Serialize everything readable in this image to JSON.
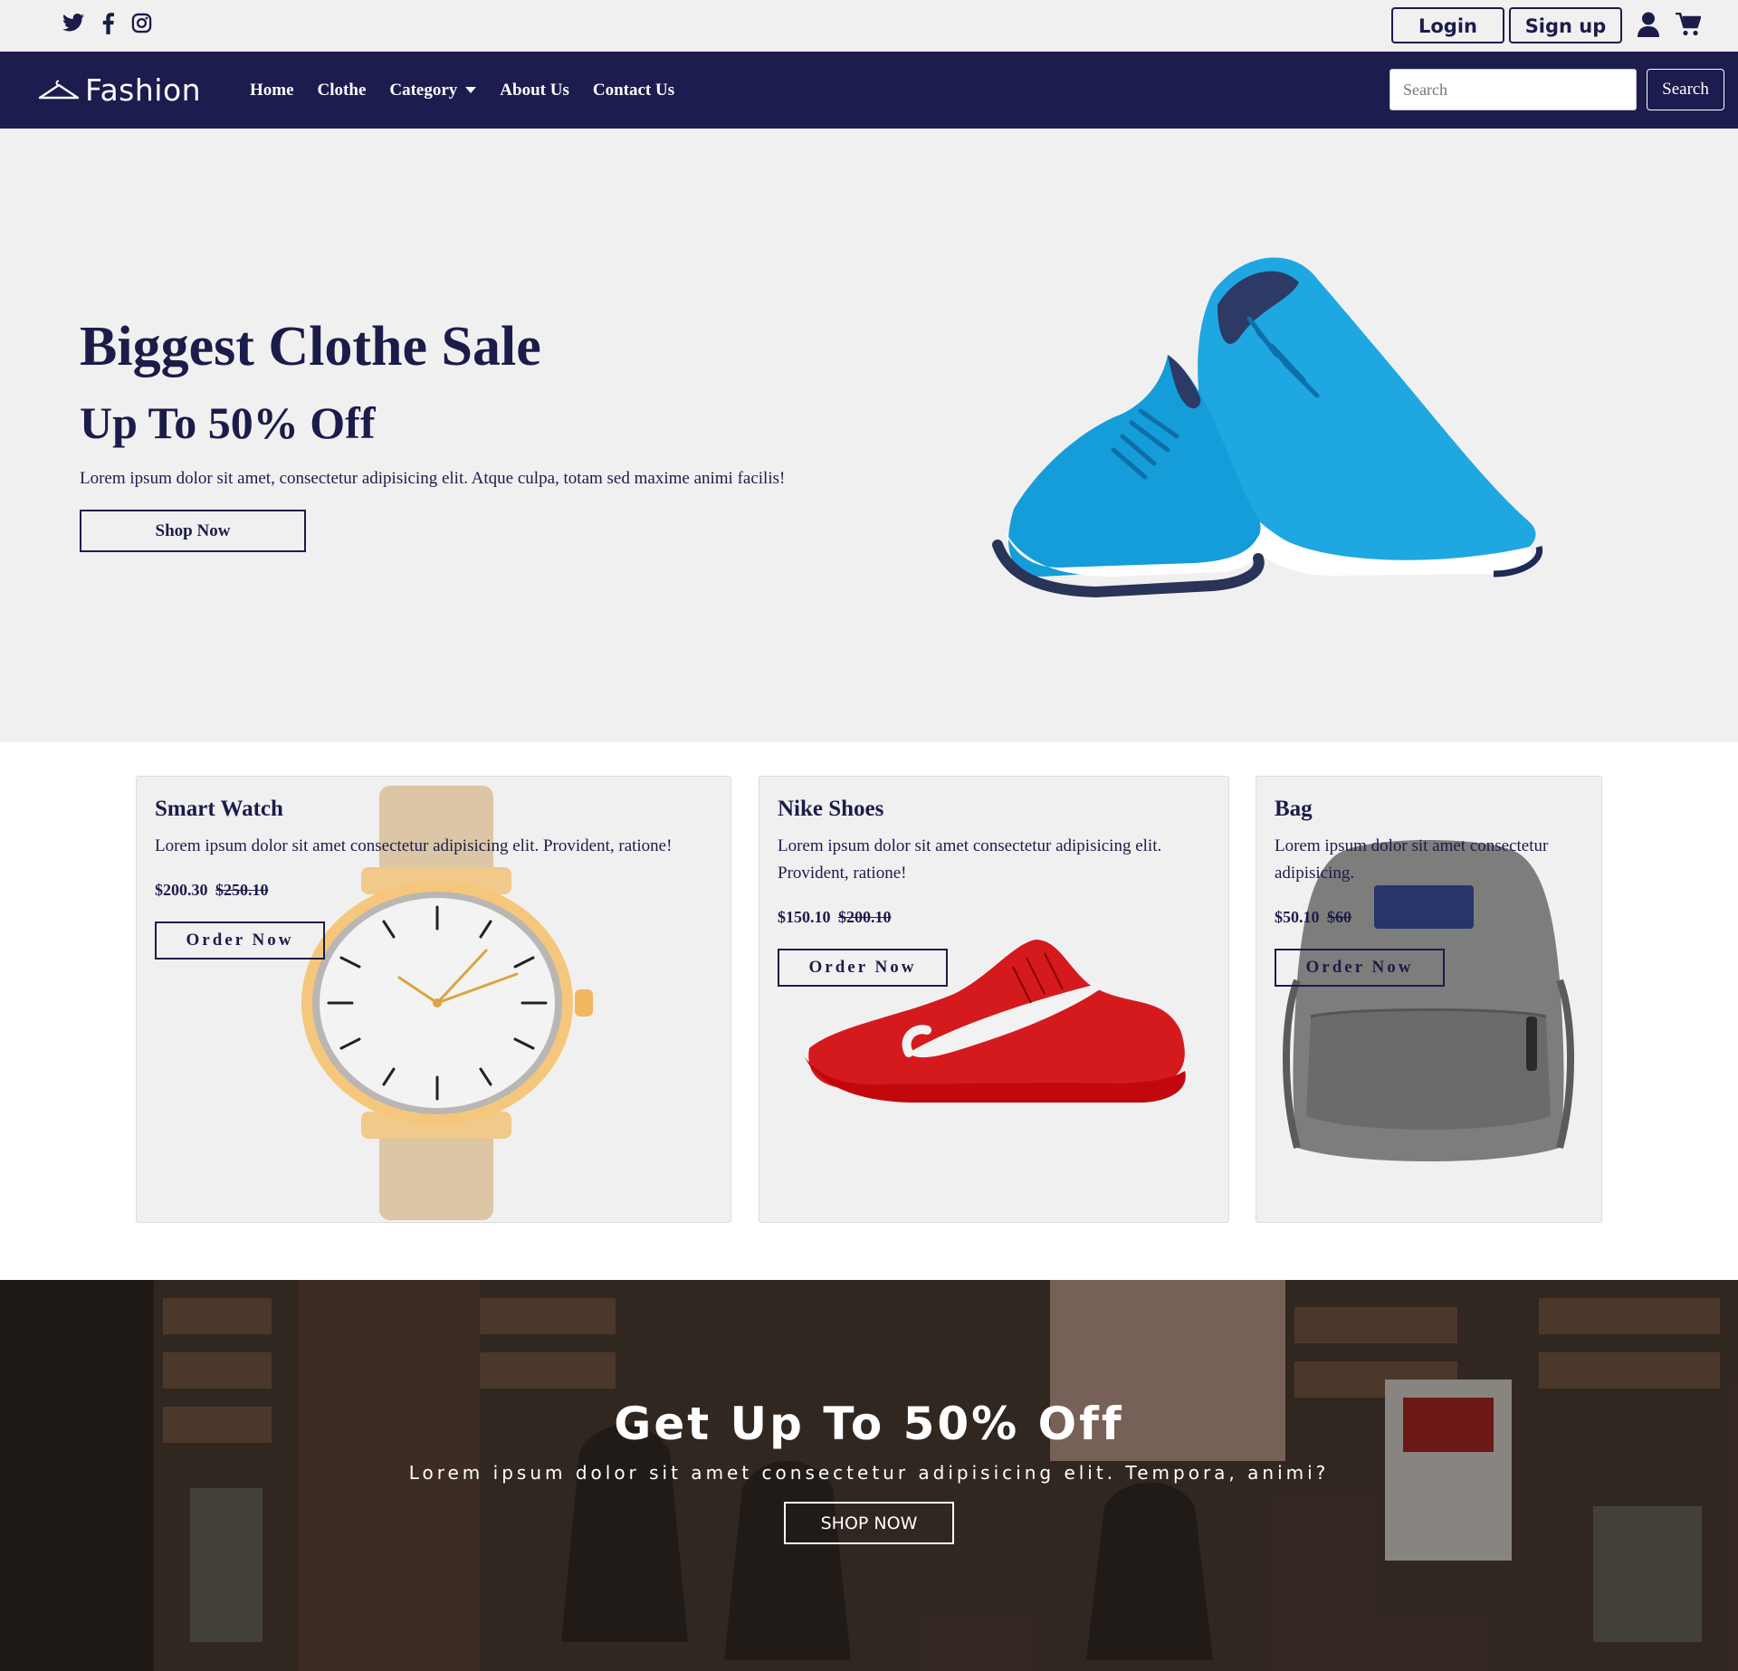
{
  "topbar": {
    "social": [
      {
        "icon": "twitter-icon"
      },
      {
        "icon": "facebook-icon"
      },
      {
        "icon": "instagram-icon"
      }
    ],
    "login_label": "Login",
    "signup_label": "Sign up",
    "user_icon": "user-icon",
    "cart_icon": "cart-icon"
  },
  "navbar": {
    "brand": "Fashion",
    "links": {
      "home": "Home",
      "clothe": "Clothe",
      "category": "Category",
      "about": "About Us",
      "contact": "Contact Us"
    },
    "search_placeholder": "Search",
    "search_button": "Search"
  },
  "hero": {
    "title": "Biggest Clothe Sale",
    "subtitle": "Up To 50% Off",
    "description": "Lorem ipsum dolor sit amet, consectetur adipisicing elit. Atque culpa, totam sed maxime animi facilis!",
    "button": "Shop Now"
  },
  "products": [
    {
      "name": "Smart Watch",
      "description": "Lorem ipsum dolor sit amet consectetur adipisicing elit. Provident, ratione!",
      "price": "$200.30",
      "old_price": "$250.10",
      "button": "Order Now"
    },
    {
      "name": "Nike Shoes",
      "description": "Lorem ipsum dolor sit amet consectetur adipisicing elit. Provident, ratione!",
      "price": "$150.10",
      "old_price": "$200.10",
      "button": "Order Now"
    },
    {
      "name": "Bag",
      "description": "Lorem ipsum dolor sit amet consectetur adipisicing.",
      "price": "$50.10",
      "old_price": "$60",
      "button": "Order Now"
    }
  ],
  "promo": {
    "title": "Get Up To 50% Off",
    "text": "Lorem ipsum dolor sit amet consectetur adipisicing elit. Tempora, animi?",
    "button": "SHOP NOW"
  },
  "colors": {
    "navy": "#1c1c4f",
    "light_bg": "#f1f0f1",
    "shoe_blue": "#1aa3dc",
    "shoe_red": "#d81a1a"
  }
}
